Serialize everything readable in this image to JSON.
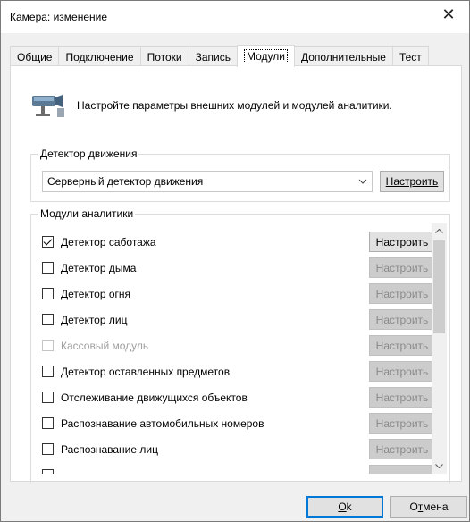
{
  "window": {
    "title": "Камера: изменение",
    "close_glyph": "✕"
  },
  "tabs": [
    {
      "label": "Общие"
    },
    {
      "label": "Подключение"
    },
    {
      "label": "Потоки"
    },
    {
      "label": "Запись"
    },
    {
      "label": "Модули",
      "active": true
    },
    {
      "label": "Дополнительные"
    },
    {
      "label": "Тест"
    }
  ],
  "intro": {
    "icon": "camera-icon",
    "text": "Настройте параметры внешних модулей и модулей аналитики."
  },
  "motion_detector": {
    "legend": "Детектор движения",
    "selected": "Серверный детектор движения",
    "configure_label": "Настроить"
  },
  "analytics": {
    "legend": "Модули аналитики",
    "items": [
      {
        "label": "Детектор саботажа",
        "checked": true,
        "enabled": true,
        "button": "Настроить",
        "button_enabled": true
      },
      {
        "label": "Детектор дыма",
        "checked": false,
        "enabled": true,
        "button": "Настроить",
        "button_enabled": false
      },
      {
        "label": "Детектор огня",
        "checked": false,
        "enabled": true,
        "button": "Настроить",
        "button_enabled": false
      },
      {
        "label": "Детектор лиц",
        "checked": false,
        "enabled": true,
        "button": "Настроить",
        "button_enabled": false
      },
      {
        "label": "Кассовый модуль",
        "checked": false,
        "enabled": false,
        "button": "Настроить",
        "button_enabled": false
      },
      {
        "label": "Детектор оставленных предметов",
        "checked": false,
        "enabled": true,
        "button": "Настроить",
        "button_enabled": false
      },
      {
        "label": "Отслеживание движущихся объектов",
        "checked": false,
        "enabled": true,
        "button": "Настроить",
        "button_enabled": false
      },
      {
        "label": "Распознавание автомобильных номеров",
        "checked": false,
        "enabled": true,
        "button": "Настроить",
        "button_enabled": false
      },
      {
        "label": "Распознавание лиц",
        "checked": false,
        "enabled": true,
        "button": "Настроить",
        "button_enabled": false
      },
      {
        "label": "",
        "checked": false,
        "enabled": true,
        "button": "",
        "button_enabled": false
      }
    ]
  },
  "footer": {
    "ok_label": "Ok",
    "ok_underline": "O",
    "ok_rest": "k",
    "cancel_prefix": "О",
    "cancel_underline": "т",
    "cancel_rest": "мена"
  }
}
